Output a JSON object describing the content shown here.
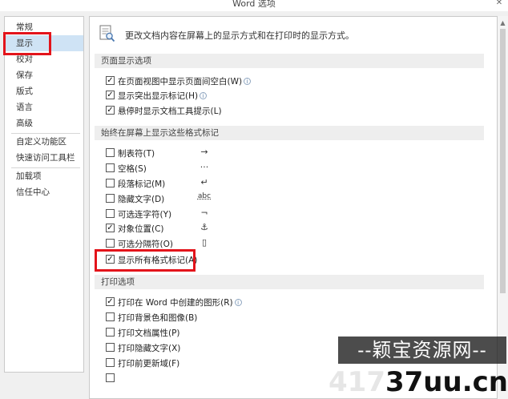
{
  "window": {
    "title": "Word 选项",
    "close_glyph": "✕"
  },
  "sidebar": {
    "items": [
      {
        "label": "常规"
      },
      {
        "label": "显示"
      },
      {
        "label": "校对"
      },
      {
        "label": "保存"
      },
      {
        "label": "版式"
      },
      {
        "label": "语言"
      },
      {
        "label": "高级"
      },
      {
        "label": "自定义功能区"
      },
      {
        "label": "快速访问工具栏"
      },
      {
        "label": "加载项"
      },
      {
        "label": "信任中心"
      }
    ],
    "selected": "显示"
  },
  "content": {
    "intro": "更改文档内容在屏幕上的显示方式和在打印时的显示方式。",
    "sections": [
      {
        "title": "页面显示选项",
        "options": [
          {
            "label": "在页面视图中显示页面间空白(W)",
            "checked": true,
            "info": true
          },
          {
            "label": "显示突出显示标记(H)",
            "checked": true,
            "info": true
          },
          {
            "label": "悬停时显示文档工具提示(L)",
            "checked": true,
            "info": false
          }
        ]
      },
      {
        "title": "始终在屏幕上显示这些格式标记",
        "options": [
          {
            "label": "制表符(T)",
            "checked": false,
            "mark": "→"
          },
          {
            "label": "空格(S)",
            "checked": false,
            "mark": "···"
          },
          {
            "label": "段落标记(M)",
            "checked": false,
            "mark": "↵"
          },
          {
            "label": "隐藏文字(D)",
            "checked": false,
            "mark": "abc"
          },
          {
            "label": "可选连字符(Y)",
            "checked": false,
            "mark": "¬"
          },
          {
            "label": "对象位置(C)",
            "checked": true,
            "mark": "⚓"
          },
          {
            "label": "可选分隔符(O)",
            "checked": false,
            "mark": "▯"
          },
          {
            "label": "显示所有格式标记(A)",
            "checked": true,
            "mark": ""
          }
        ]
      },
      {
        "title": "打印选项",
        "options": [
          {
            "label": "打印在 Word 中创建的图形(R)",
            "checked": true,
            "info": true
          },
          {
            "label": "打印背景色和图像(B)",
            "checked": false
          },
          {
            "label": "打印文档属性(P)",
            "checked": false
          },
          {
            "label": "打印隐藏文字(X)",
            "checked": false
          },
          {
            "label": "打印前更新域(F)",
            "checked": false
          }
        ]
      }
    ]
  },
  "watermark": {
    "banner": "--颖宝资源网--",
    "domain_a": "417",
    "domain_b": "37uu.cn"
  },
  "colors": {
    "highlight": "#e3141b",
    "selected_nav": "#cfe3f5",
    "section_bg": "#eeeeee"
  }
}
